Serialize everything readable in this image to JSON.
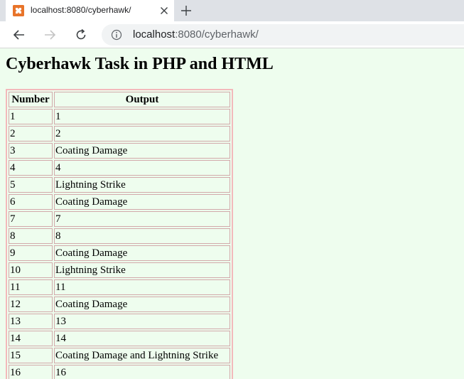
{
  "browser": {
    "tab": {
      "title": "localhost:8080/cyberhawk/",
      "favicon": "xampp-icon"
    },
    "address": {
      "host": "localhost",
      "rest": ":8080/cyberhawk/"
    }
  },
  "page": {
    "heading": "Cyberhawk Task in PHP and HTML",
    "table": {
      "headers": [
        "Number",
        "Output"
      ],
      "rows": [
        {
          "number": "1",
          "output": "1"
        },
        {
          "number": "2",
          "output": "2"
        },
        {
          "number": "3",
          "output": "Coating Damage"
        },
        {
          "number": "4",
          "output": "4"
        },
        {
          "number": "5",
          "output": "Lightning Strike"
        },
        {
          "number": "6",
          "output": "Coating Damage"
        },
        {
          "number": "7",
          "output": "7"
        },
        {
          "number": "8",
          "output": "8"
        },
        {
          "number": "9",
          "output": "Coating Damage"
        },
        {
          "number": "10",
          "output": "Lightning Strike"
        },
        {
          "number": "11",
          "output": "11"
        },
        {
          "number": "12",
          "output": "Coating Damage"
        },
        {
          "number": "13",
          "output": "13"
        },
        {
          "number": "14",
          "output": "14"
        },
        {
          "number": "15",
          "output": "Coating Damage and Lightning Strike"
        },
        {
          "number": "16",
          "output": "16"
        }
      ]
    }
  },
  "colors": {
    "page_background": "#eefdee",
    "table_border": "#f3b9bb",
    "favicon": "#e8742a"
  }
}
